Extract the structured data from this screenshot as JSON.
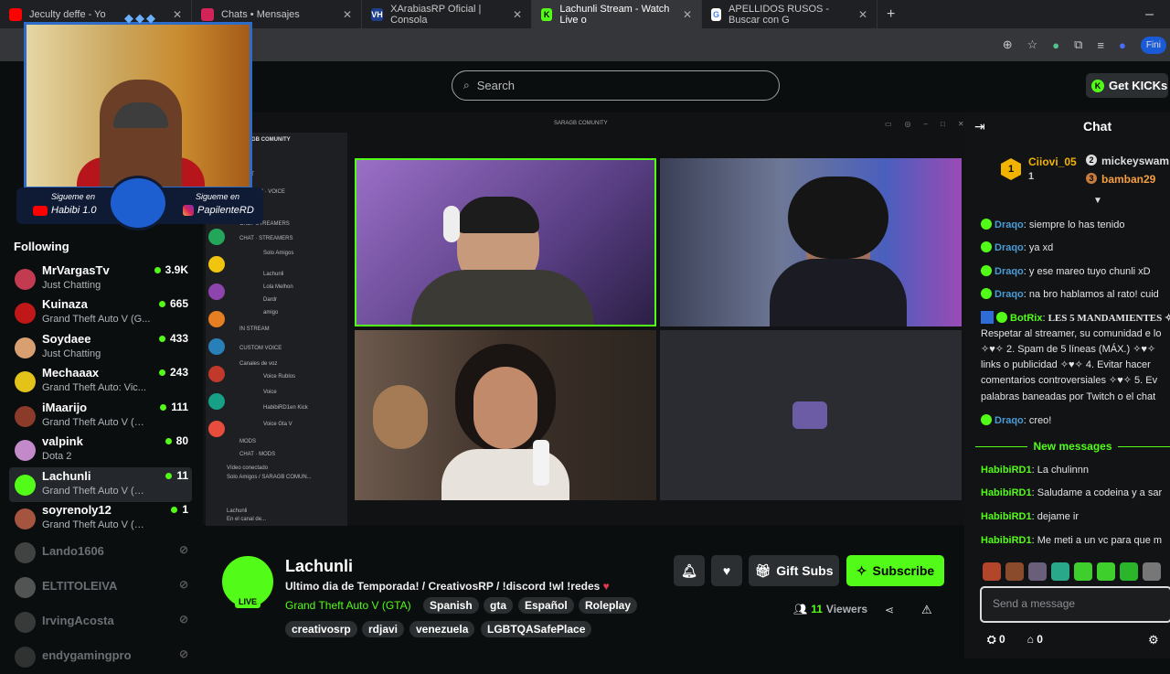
{
  "browser": {
    "tabs": [
      {
        "label": "Jeculty deffe - Yo",
        "active": false
      },
      {
        "label": "Chats • Mensajes",
        "active": false
      },
      {
        "label": "XArabiasRP Oficial | Consola",
        "active": false
      },
      {
        "label": "Lachunli Stream - Watch Live o",
        "active": true
      },
      {
        "label": "APELLIDOS RUSOS - Buscar con G",
        "active": false
      }
    ],
    "new_tab": "+",
    "minimize": "–",
    "profile": "Fini"
  },
  "header": {
    "search_placeholder": "Search",
    "get_kicks": "Get KICKs"
  },
  "webcam": {
    "follow_left_label": "Siguеme en",
    "follow_left_handle": "Habibi 1.0",
    "follow_right_label": "Siguеme en",
    "follow_right_handle": "PapilenteRD"
  },
  "sidebar": {
    "heading": "Following",
    "channels": [
      {
        "name": "MrVargasTv",
        "category": "Just Chatting",
        "viewers": "3.9K",
        "live": true,
        "color": "#c23b50"
      },
      {
        "name": "Kuinaza",
        "category": "Grand Theft Auto V (G...",
        "viewers": "665",
        "live": true,
        "color": "#c01818"
      },
      {
        "name": "Soydaee",
        "category": "Just Chatting",
        "viewers": "433",
        "live": true,
        "color": "#d8a070"
      },
      {
        "name": "Mechaaax",
        "category": "Grand Theft Auto: Vic...",
        "viewers": "243",
        "live": true,
        "color": "#e3c21a"
      },
      {
        "name": "iMaarijo",
        "category": "Grand Theft Auto V (GTA)",
        "viewers": "111",
        "live": true,
        "color": "#8a3b2a"
      },
      {
        "name": "valpink",
        "category": "Dota 2",
        "viewers": "80",
        "live": true,
        "color": "#c28ac9"
      },
      {
        "name": "Lachunli",
        "category": "Grand Theft Auto V (GTA)",
        "viewers": "11",
        "live": true,
        "color": "#53fc18"
      },
      {
        "name": "soyrenoly12",
        "category": "Grand Theft Auto V (GTA)",
        "viewers": "1",
        "live": true,
        "color": "#a4543f"
      },
      {
        "name": "Lando1606",
        "category": "",
        "viewers": "",
        "live": false,
        "color": "#777"
      },
      {
        "name": "ELTITOLEIVA",
        "category": "",
        "viewers": "",
        "live": false,
        "color": "#999"
      },
      {
        "name": "IrvingAcosta",
        "category": "",
        "viewers": "",
        "live": false,
        "color": "#666"
      },
      {
        "name": "endygamingpro",
        "category": "",
        "viewers": "",
        "live": false,
        "color": "#555"
      }
    ]
  },
  "video": {
    "window_title": "SARAGB COMUNITY",
    "server_name": "SARAGB COMUNITY",
    "discord_items": [
      "CHAT",
      "CUSTOM · VOICE",
      "VOICE",
      "ONLY STREAMERS",
      "CHAT · STREAMERS",
      "Solo Amigos",
      "Lachunli",
      "Lola Melhon",
      "Dardr",
      "amigo",
      "IN STREAM",
      "CUSTOM VOICE",
      "Canales de voz",
      "Voice Rublos",
      "Voice",
      "HabibiRD1en Kick",
      "Voice Gta V",
      "MODS",
      "CHAT · MODS",
      "Vídeo conectado",
      "Solo Amigos / SARAGB COMUN...",
      "Lachunli",
      "En el canal de..."
    ]
  },
  "channel": {
    "name": "Lachunli",
    "live_label": "LIVE",
    "title": "Ultimo dia de Temporada! / CreativosRP / !discord !wl !redes",
    "category": "Grand Theft Auto V (GTA)",
    "tags_row1": [
      "Spanish",
      "gta",
      "Español",
      "Roleplay"
    ],
    "tags_row2": [
      "creativosrp",
      "rdjavi",
      "venezuela",
      "LGBTQASafePlace"
    ],
    "gift_subs": "Gift Subs",
    "subscribe": "Subscribe",
    "viewers_count": "11",
    "viewers_label": "Viewers"
  },
  "chat": {
    "title": "Chat",
    "top_gifters": [
      {
        "rank": "1",
        "name": "Ciiovi_05",
        "count": "1"
      },
      {
        "rank": "2",
        "name": "mickeyswam"
      },
      {
        "rank": "3",
        "name": "bamban29"
      }
    ],
    "messages": [
      {
        "user": "Draqo",
        "text": "siempre lo has tenido"
      },
      {
        "user": "Draqo",
        "text": "ya xd"
      },
      {
        "user": "Draqo",
        "text": "y ese mareo tuyo chunli xD"
      },
      {
        "user": "Draqo",
        "text": "na bro hablamos al rato! cuid"
      }
    ],
    "botrix": {
      "user": "BotRix",
      "lines": [
        "LES 5 MANDAMIENTES ✧",
        "Respetar al streamer, su comunidad e lo",
        "✧♥✧ 2. Spam de 5 líneas (MÁX.) ✧♥✧",
        "links o publicidad ✧♥✧ 4. Evitar hacer",
        "comentarios controversiales ✧♥✧ 5. Ev",
        "palabras baneadas por Twitch o el chat"
      ]
    },
    "last_old": {
      "user": "Draqo",
      "text": "creo!"
    },
    "new_messages_label": "New messages",
    "new_messages": [
      {
        "user": "HabibiRD1",
        "text": "La chulinnn"
      },
      {
        "user": "HabibiRD1",
        "text": "Saludame a codeina y a sar"
      },
      {
        "user": "HabibiRD1",
        "text": "dejame ir"
      },
      {
        "user": "HabibiRD1",
        "text": "Me meti a un vc para que m"
      }
    ],
    "input_placeholder": "Send a message",
    "kicks_count": "0",
    "store_count": "0"
  }
}
